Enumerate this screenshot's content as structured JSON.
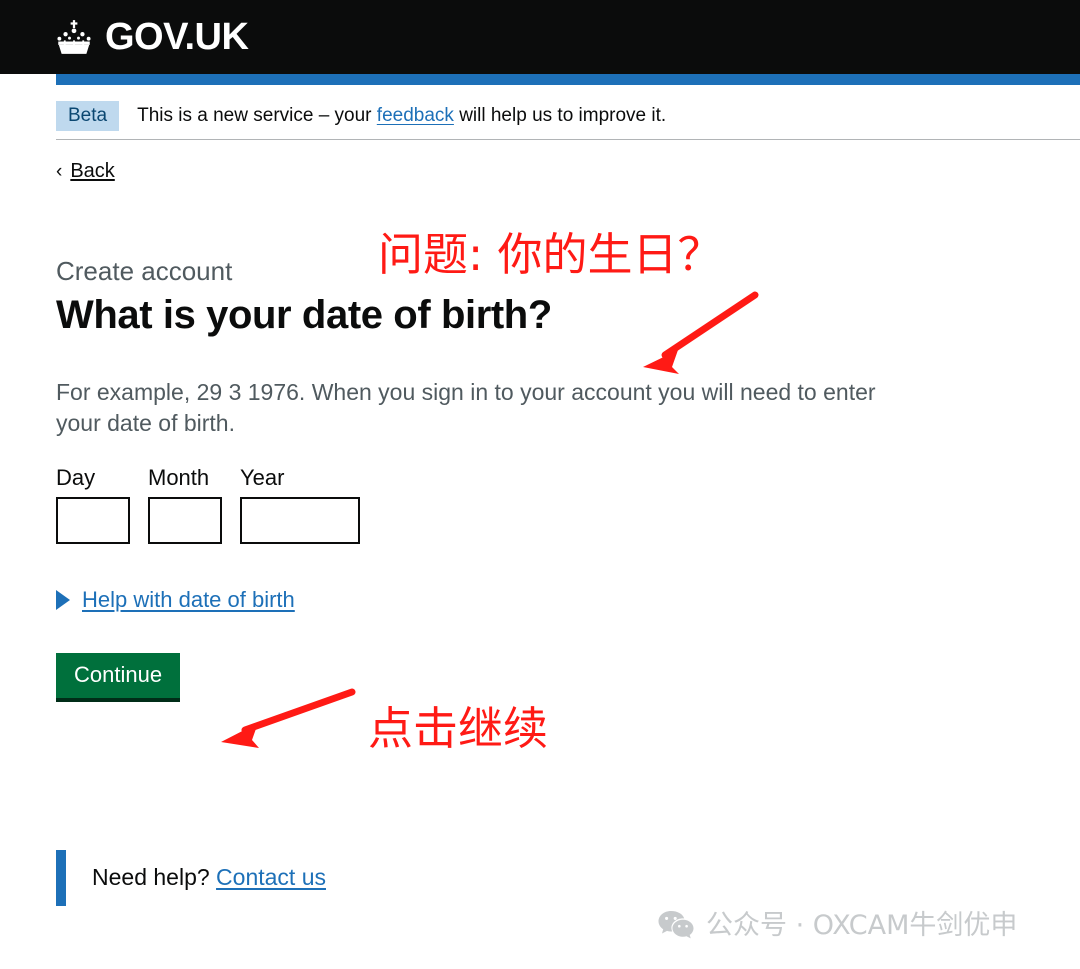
{
  "header": {
    "logo_icon": "crown-icon",
    "logotype": "GOV.UK",
    "background_color": "#0b0c0c",
    "accent_bar_color": "#1d70b8"
  },
  "phase_banner": {
    "tag": "Beta",
    "text_before_link": "This is a new service – your ",
    "link": "feedback",
    "text_after_link": " will help us to improve it.",
    "tag_bg_color": "#bfd9ee",
    "tag_text_color": "#0b4771"
  },
  "back_link": {
    "chevron": "‹",
    "label": "Back"
  },
  "main": {
    "caption": "Create account",
    "heading": "What is your date of birth?",
    "hint": "For example, 29 3 1976. When you sign in to your account you will need to enter your date of birth.",
    "date_fields": [
      {
        "label": "Day",
        "value": "",
        "width": "short"
      },
      {
        "label": "Month",
        "value": "",
        "width": "short"
      },
      {
        "label": "Year",
        "value": "",
        "width": "long"
      }
    ],
    "details": {
      "arrow_icon": "triangle-right-icon",
      "summary": "Help with date of birth",
      "expanded": false
    },
    "continue_button": {
      "label": "Continue",
      "background_color": "#00703c",
      "shadow_color": "#002d18"
    }
  },
  "inset": {
    "text": "Need help? ",
    "link": "Contact us",
    "border_color": "#1d70b8"
  },
  "annotations": {
    "color": "#ff1a15",
    "question_note": "问题: 你的生日？",
    "click_note": "点击继续",
    "arrow_to_heading": "arrow-down-left-icon",
    "arrow_to_continue": "arrow-down-left-icon"
  },
  "watermark": {
    "icon": "wechat-icon",
    "text": "公众号 · OXCAM牛剑优申",
    "color": "#c3c6c8"
  }
}
